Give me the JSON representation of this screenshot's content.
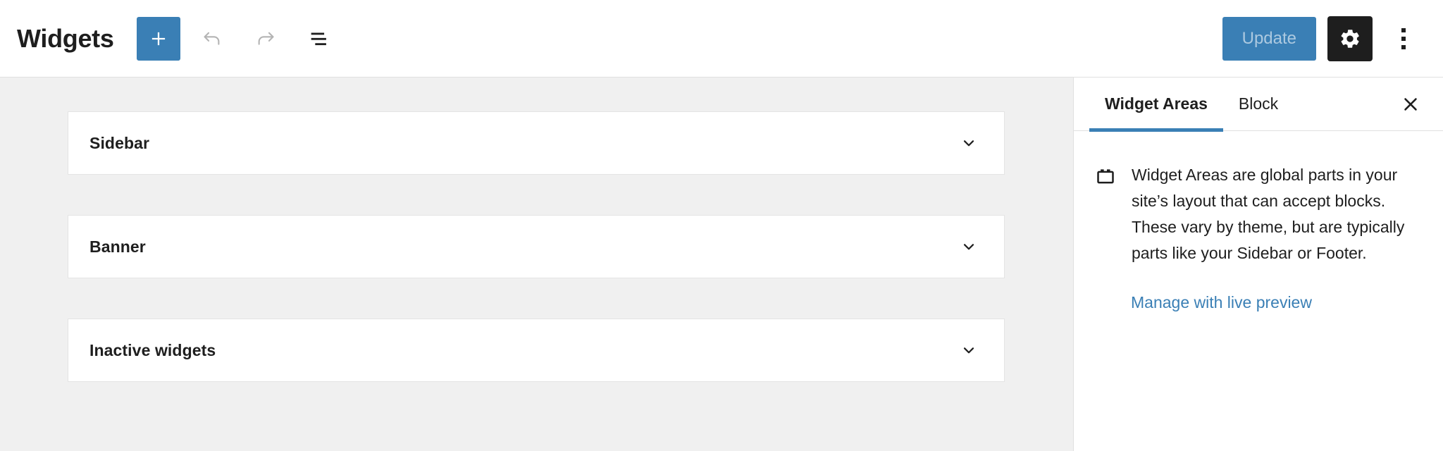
{
  "header": {
    "title": "Widgets",
    "add_block_label": "Add block",
    "undo_label": "Undo",
    "redo_label": "Redo",
    "list_view_label": "List View",
    "update_label": "Update",
    "settings_label": "Settings",
    "options_label": "Options"
  },
  "main": {
    "widget_areas": [
      {
        "name": "Sidebar"
      },
      {
        "name": "Banner"
      },
      {
        "name": "Inactive widgets"
      }
    ]
  },
  "sidebar": {
    "tabs": [
      {
        "label": "Widget Areas",
        "active": true
      },
      {
        "label": "Block",
        "active": false
      }
    ],
    "close_label": "Close settings",
    "info": {
      "icon": "widget-area-icon",
      "description": "Widget Areas are global parts in your site’s layout that can accept blocks. These vary by theme, but are typically parts like your Sidebar or Footer.",
      "link_label": "Manage with live preview"
    }
  },
  "colors": {
    "accent": "#3a7fb5",
    "dark": "#1e1e1e",
    "canvas": "#f0f0f0",
    "panel": "#ffffff",
    "border": "#e0e0e0",
    "muted_icon": "#b0b0b0"
  }
}
